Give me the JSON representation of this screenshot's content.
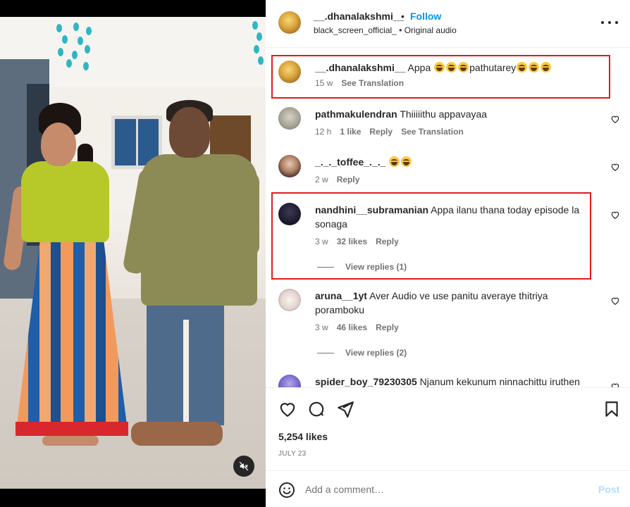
{
  "post": {
    "username": "__.dhanalakshmi__",
    "separator": "•",
    "follow_label": "Follow",
    "subtitle": "black_screen_official_ • Original audio"
  },
  "comments": [
    {
      "username": "__.dhanalakshmi__",
      "text_before": "Appa",
      "emoji_before_count": 3,
      "text_mid": "pathutarey",
      "emoji_after_count": 3,
      "time": "15 w",
      "see_translation": "See Translation",
      "avatar": "gold-portrait",
      "highlighted": true
    },
    {
      "username": "pathmakulendran",
      "text": "Thiiiiithu appavayaa",
      "time": "12 h",
      "likes": "1 like",
      "reply": "Reply",
      "see_translation": "See Translation",
      "avatar": "idol-portrait"
    },
    {
      "username": "_._._toffee_._._",
      "emoji_count": 2,
      "time": "2 w",
      "reply": "Reply",
      "avatar": "glasses-portrait"
    },
    {
      "username": "nandhini__subramanian",
      "text": "Appa ilanu thana today episode la sonaga",
      "time": "3 w",
      "likes": "32 likes",
      "reply": "Reply",
      "view_replies": "View replies (1)",
      "avatar": "dark-portrait",
      "highlighted": true
    },
    {
      "username": "aruna__1yt",
      "text": "Aver Audio ve use panitu averaye thitriya poramboku",
      "time": "3 w",
      "likes": "46 likes",
      "reply": "Reply",
      "view_replies": "View replies (2)",
      "avatar": "flower-portrait"
    },
    {
      "username": "spider_boy_79230305",
      "text": "Njanum kekunum ninnachittu iruthen",
      "avatar": "purple-portrait"
    }
  ],
  "likes_count": "5,254 likes",
  "post_date": "JULY 23",
  "add_comment": {
    "placeholder": "Add a comment…",
    "post_label": "Post"
  },
  "icons": {
    "like": "heart-icon",
    "comment": "comment-icon",
    "share": "share-icon",
    "save": "bookmark-icon",
    "emoji": "emoji-icon",
    "more": "more-icon",
    "mute": "mute-icon"
  },
  "colors": {
    "accent": "#0095f6",
    "highlight_box": "#e21b1b",
    "secondary_text": "#737373",
    "post_button_disabled": "#b2dffc"
  }
}
